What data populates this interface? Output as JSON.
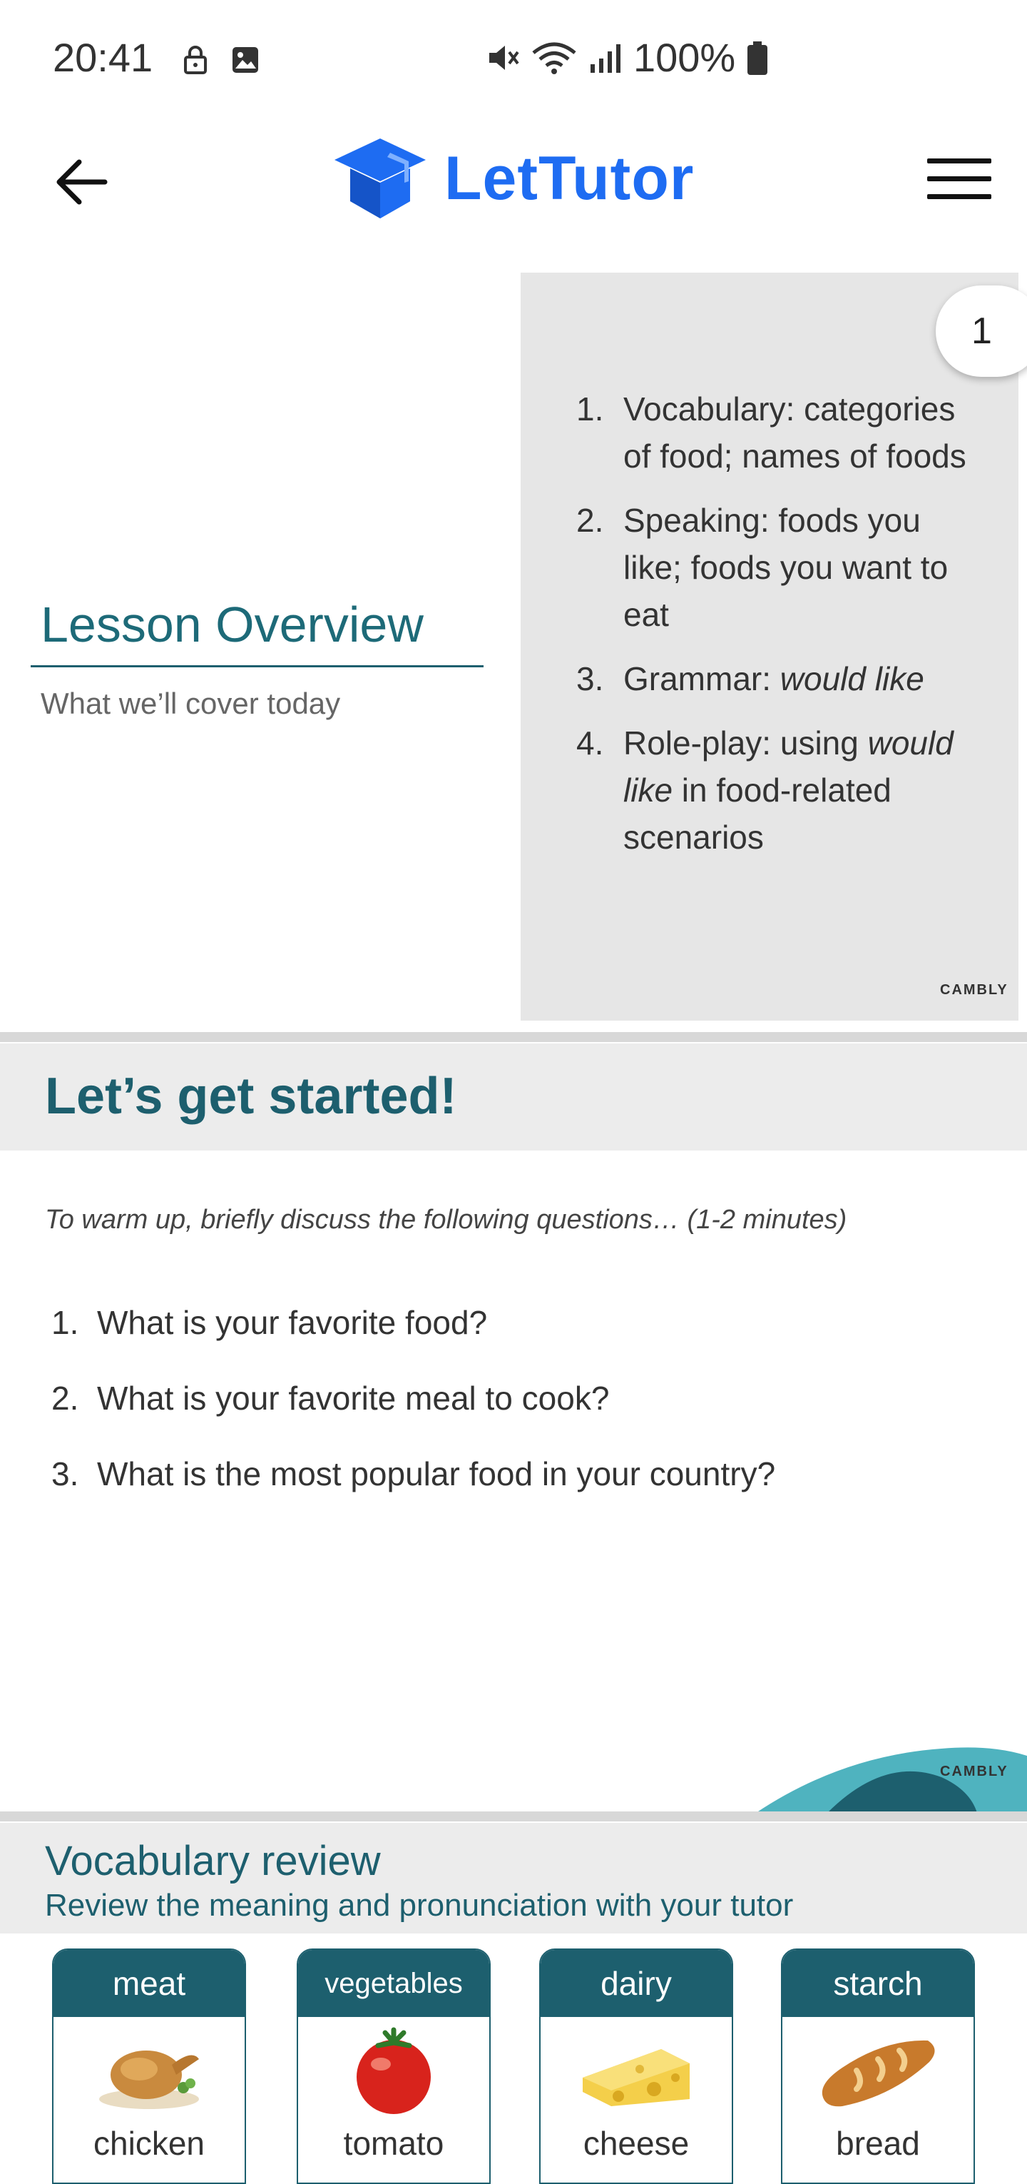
{
  "status_bar": {
    "time": "20:41",
    "battery": "100%"
  },
  "header": {
    "app_name": "LetTutor"
  },
  "slide1": {
    "page_number": "1",
    "title": "Lesson Overview",
    "subtitle": "What we’ll cover today",
    "items": [
      {
        "num": "1.",
        "text": "Vocabulary: categories of food; names of foods"
      },
      {
        "num": "2.",
        "text": "Speaking: foods you like; foods you want to eat"
      },
      {
        "num": "3.",
        "pre": "Grammar: ",
        "em": "would like",
        "post": ""
      },
      {
        "num": "4.",
        "pre": "Role-play: using ",
        "em": "would like",
        "post": " in food-related scenarios"
      }
    ],
    "brand": "CAMBLY"
  },
  "slide2": {
    "title": "Let’s get started!",
    "instruction": "To warm up, briefly discuss the following questions… (1-2 minutes)",
    "questions": [
      {
        "num": "1.",
        "text": "What is your favorite food?"
      },
      {
        "num": "2.",
        "text": "What is your favorite meal to cook?"
      },
      {
        "num": "3.",
        "text": "What is the most popular food in your country?"
      }
    ],
    "brand": "CAMBLY"
  },
  "slide3": {
    "title": "Vocabulary review",
    "subtitle": "Review the meaning and pronunciation with your tutor",
    "cards": [
      {
        "category": "meat",
        "word": "chicken"
      },
      {
        "category": "vegetables",
        "word": "tomato"
      },
      {
        "category": "dairy",
        "word": "cheese"
      },
      {
        "category": "starch",
        "word": "bread"
      }
    ]
  },
  "colors": {
    "brand_blue": "#1e6cf2",
    "slide_teal": "#1d5f6e",
    "accent_cyan": "#4fb3bf"
  }
}
